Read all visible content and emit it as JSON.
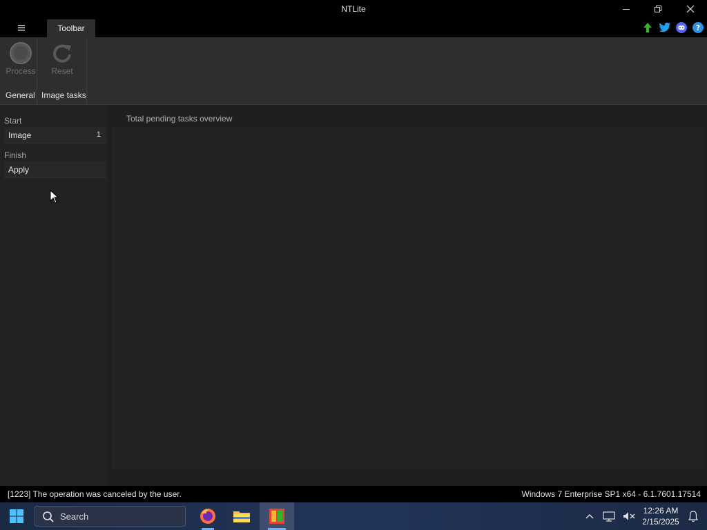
{
  "window": {
    "title": "NTLite"
  },
  "tabs": {
    "toolbar": "Toolbar"
  },
  "ribbon": {
    "buttons": {
      "process": "Process",
      "reset": "Reset"
    },
    "groups": {
      "general": "General",
      "image_tasks": "Image tasks"
    }
  },
  "sidebar": {
    "start_label": "Start",
    "image_label": "Image",
    "image_count": "1",
    "finish_label": "Finish",
    "apply_label": "Apply"
  },
  "main": {
    "header": "Total pending tasks overview"
  },
  "status": {
    "message": "[1223] The operation was canceled by the user.",
    "os_info": "Windows 7 Enterprise SP1 x64 - 6.1.7601.17514"
  },
  "taskbar": {
    "search_placeholder": "Search",
    "time": "12:26 AM",
    "date": "2/15/2025"
  },
  "icons": {
    "menu": "hamburger-icon",
    "update": "arrow-up-icon",
    "twitter": "twitter-icon",
    "discord": "discord-icon",
    "help": "help-icon"
  },
  "colors": {
    "accent": "#6ab0ff",
    "update_green": "#2eb82e",
    "twitter_blue": "#1da1f2",
    "discord_purple": "#5865f2",
    "help_blue": "#2f8fe0"
  }
}
